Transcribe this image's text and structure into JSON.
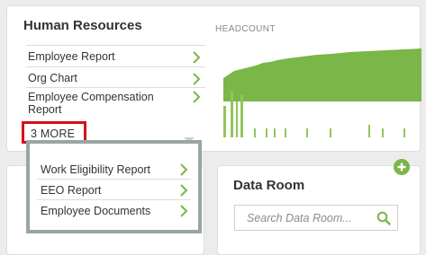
{
  "hr_widget": {
    "title": "Human Resources",
    "items": [
      {
        "label": "Employee Report"
      },
      {
        "label": "Org Chart"
      },
      {
        "label": "Employee Compensation Report"
      }
    ],
    "more_label": "3 MORE",
    "chart_label": "HEADCOUNT"
  },
  "dropdown": {
    "items": [
      {
        "label": "Work Eligibility Report"
      },
      {
        "label": "EEO Report"
      },
      {
        "label": "Employee Documents"
      }
    ]
  },
  "data_room": {
    "title": "Data Room",
    "search_placeholder": "Search Data Room..."
  },
  "colors": {
    "accent_green": "#7ab648",
    "highlight_red": "#d80e1b",
    "dropdown_border": "#9aa5a3"
  },
  "icons": {
    "chevron": "chevron-right-icon",
    "caret": "caret-down-icon",
    "search": "search-icon",
    "add": "plus-icon"
  }
}
